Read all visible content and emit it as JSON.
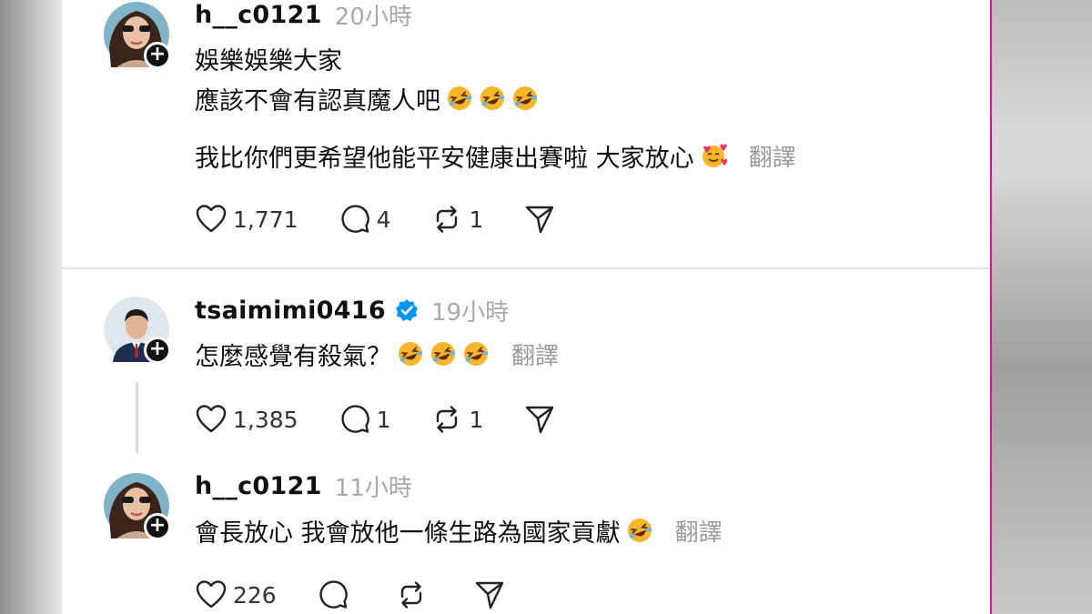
{
  "posts": [
    {
      "username": "h__c0121",
      "time": "20小時",
      "verified": false,
      "lines": [
        "娛樂娛樂大家",
        "應該不會有認真魔人吧",
        "我比你們更希望他能平安健康出賽啦 大家放心"
      ],
      "translate_label": "翻譯",
      "likes": "1,771",
      "replies": "4",
      "reposts": "1"
    },
    {
      "username": "tsaimimi0416",
      "time": "19小時",
      "verified": true,
      "lines": [
        "怎麼感覺有殺氣？"
      ],
      "translate_label": "翻譯",
      "likes": "1,385",
      "replies": "1",
      "reposts": "1"
    },
    {
      "username": "h__c0121",
      "time": "11小時",
      "verified": false,
      "lines": [
        "會長放心 我會放他一條生路為國家貢獻"
      ],
      "translate_label": "翻譯",
      "likes": "226",
      "replies": "",
      "reposts": ""
    }
  ],
  "icons": {
    "follow": "plus-icon",
    "like": "heart-icon",
    "reply": "comment-icon",
    "repost": "repost-icon",
    "share": "send-icon",
    "verified": "verified-badge-icon",
    "emoji_laugh": "rolling-on-floor-laughing-emoji",
    "emoji_hearts": "smiling-face-with-hearts-emoji"
  },
  "colors": {
    "verified": "#0095f6",
    "muted": "#a9a9a9",
    "emoji": "#f7b52a"
  }
}
